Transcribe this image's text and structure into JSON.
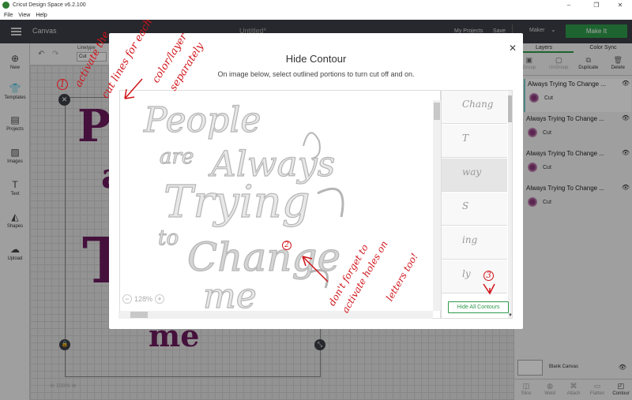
{
  "window": {
    "title": "Cricut Design Space  v6.2.100",
    "minimize": "–",
    "maximize": "❐",
    "close": "✕"
  },
  "menu": [
    "File",
    "View",
    "Help"
  ],
  "header": {
    "canvas_label": "Canvas",
    "project_title": "Untitled*",
    "my_projects": "My Projects",
    "save": "Save",
    "machine": "Maker",
    "make_it": "Make It"
  },
  "left_toolbar": [
    {
      "icon": "plus-icon",
      "label": "New"
    },
    {
      "icon": "shirt-icon",
      "label": "Templates"
    },
    {
      "icon": "projects-icon",
      "label": "Projects"
    },
    {
      "icon": "images-icon",
      "label": "Images"
    },
    {
      "icon": "text-icon",
      "label": "Text"
    },
    {
      "icon": "shapes-icon",
      "label": "Shapes"
    },
    {
      "icon": "upload-icon",
      "label": "Upload"
    }
  ],
  "edit_bar": {
    "linetype_label": "Linetype",
    "linetype_value": "Cut"
  },
  "canvas": {
    "zoom": "100%"
  },
  "layers_panel": {
    "tabs": [
      "Layers",
      "Color Sync"
    ],
    "actions": [
      {
        "label": "Group",
        "disabled": true
      },
      {
        "label": "UnGroup",
        "disabled": true
      },
      {
        "label": "Duplicate",
        "disabled": false
      },
      {
        "label": "Delete",
        "disabled": false
      }
    ],
    "layers": [
      {
        "name": "Always Trying To Change ...",
        "type": "Cut"
      },
      {
        "name": "Always Trying To Change ...",
        "type": "Cut"
      },
      {
        "name": "Always Trying To Change ...",
        "type": "Cut"
      },
      {
        "name": "Always Trying To Change ...",
        "type": "Cut"
      }
    ],
    "blank_canvas": "Blank Canvas",
    "bottom_actions": [
      {
        "label": "Slice",
        "active": false
      },
      {
        "label": "Weld",
        "active": false
      },
      {
        "label": "Attach",
        "active": false
      },
      {
        "label": "Flatten",
        "active": false
      },
      {
        "label": "Contour",
        "active": true
      }
    ]
  },
  "modal": {
    "title": "Hide Contour",
    "subtitle": "On image below, select outlined portions to turn cut off and on.",
    "zoom": "128%",
    "hide_all": "Hide All Contours",
    "contour_thumbs": [
      "Chang",
      "T",
      "way",
      "S",
      "ing",
      "ly"
    ],
    "preview_text": [
      "People",
      "are",
      "Always",
      "Trying",
      "to",
      "Change",
      "me"
    ]
  },
  "annotations": {
    "marker1": "1",
    "note1": [
      "activate the",
      "cut lines for each",
      "color/layer",
      "separately"
    ],
    "marker2": "2",
    "note2": [
      "don't forget to",
      "activate holes on",
      "letters too!"
    ],
    "marker3": "3"
  },
  "colors": {
    "accent": "#2e9a4a",
    "header": "#3b3e45",
    "design": "#6a1b5c",
    "annotation": "#d0141a"
  }
}
